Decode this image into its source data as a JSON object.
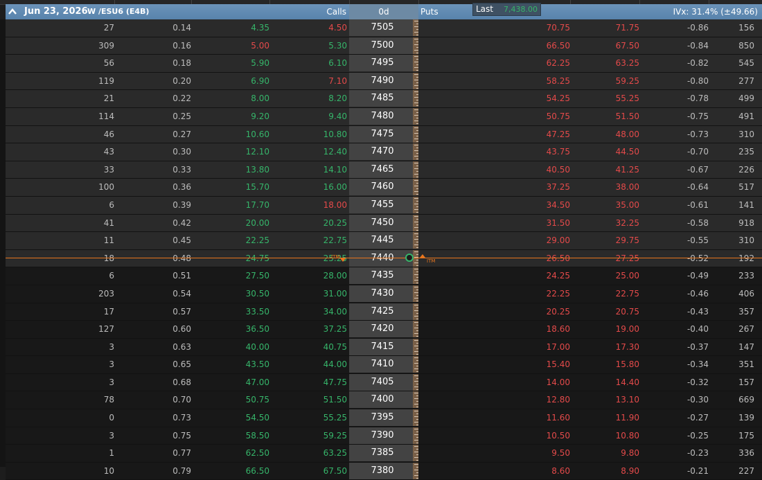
{
  "header": {
    "date": "Jun 23, 2026",
    "symbol": "W  /ESU6 (E4B)",
    "calls_label": "Calls",
    "expiration": "0d",
    "puts_label": "Puts",
    "ivx": "IVx: 31.4% (±49.66)"
  },
  "last_box": {
    "label": "Last",
    "value": "7,438.00"
  },
  "colors": {
    "header_bg": "#5f88b0",
    "itm_row": "#2a2a2a",
    "otm_row": "#181818",
    "green": "#36b56a",
    "red": "#e44a4a",
    "atm_line": "#e8761e"
  },
  "itm_label": "ITM",
  "rows": [
    {
      "c1": "27",
      "c2": "0.14",
      "bid": "4.35",
      "ask": "4.50",
      "strike": "7505",
      "pbid": "70.75",
      "pask": "71.75",
      "delta": "-0.86",
      "oi": "156",
      "bc": "green",
      "ac": "red",
      "pbc": "red",
      "pac": "red",
      "itm": true
    },
    {
      "c1": "309",
      "c2": "0.16",
      "bid": "5.00",
      "ask": "5.30",
      "strike": "7500",
      "pbid": "66.50",
      "pask": "67.50",
      "delta": "-0.84",
      "oi": "850",
      "bc": "red",
      "ac": "green",
      "pbc": "red",
      "pac": "red",
      "itm": true
    },
    {
      "c1": "56",
      "c2": "0.18",
      "bid": "5.90",
      "ask": "6.10",
      "strike": "7495",
      "pbid": "62.25",
      "pask": "63.25",
      "delta": "-0.82",
      "oi": "545",
      "bc": "green",
      "ac": "green",
      "pbc": "red",
      "pac": "red",
      "itm": true
    },
    {
      "c1": "119",
      "c2": "0.20",
      "bid": "6.90",
      "ask": "7.10",
      "strike": "7490",
      "pbid": "58.25",
      "pask": "59.25",
      "delta": "-0.80",
      "oi": "277",
      "bc": "green",
      "ac": "red",
      "pbc": "red",
      "pac": "red",
      "itm": true
    },
    {
      "c1": "21",
      "c2": "0.22",
      "bid": "8.00",
      "ask": "8.20",
      "strike": "7485",
      "pbid": "54.25",
      "pask": "55.25",
      "delta": "-0.78",
      "oi": "499",
      "bc": "green",
      "ac": "green",
      "pbc": "red",
      "pac": "red",
      "itm": true
    },
    {
      "c1": "114",
      "c2": "0.25",
      "bid": "9.20",
      "ask": "9.40",
      "strike": "7480",
      "pbid": "50.75",
      "pask": "51.50",
      "delta": "-0.75",
      "oi": "491",
      "bc": "green",
      "ac": "green",
      "pbc": "red",
      "pac": "red",
      "itm": true
    },
    {
      "c1": "46",
      "c2": "0.27",
      "bid": "10.60",
      "ask": "10.80",
      "strike": "7475",
      "pbid": "47.25",
      "pask": "48.00",
      "delta": "-0.73",
      "oi": "310",
      "bc": "green",
      "ac": "green",
      "pbc": "red",
      "pac": "red",
      "itm": true
    },
    {
      "c1": "43",
      "c2": "0.30",
      "bid": "12.10",
      "ask": "12.40",
      "strike": "7470",
      "pbid": "43.75",
      "pask": "44.50",
      "delta": "-0.70",
      "oi": "235",
      "bc": "green",
      "ac": "green",
      "pbc": "red",
      "pac": "red",
      "itm": true
    },
    {
      "c1": "33",
      "c2": "0.33",
      "bid": "13.80",
      "ask": "14.10",
      "strike": "7465",
      "pbid": "40.50",
      "pask": "41.25",
      "delta": "-0.67",
      "oi": "226",
      "bc": "green",
      "ac": "green",
      "pbc": "red",
      "pac": "red",
      "itm": true
    },
    {
      "c1": "100",
      "c2": "0.36",
      "bid": "15.70",
      "ask": "16.00",
      "strike": "7460",
      "pbid": "37.25",
      "pask": "38.00",
      "delta": "-0.64",
      "oi": "517",
      "bc": "green",
      "ac": "green",
      "pbc": "red",
      "pac": "red",
      "itm": true
    },
    {
      "c1": "6",
      "c2": "0.39",
      "bid": "17.70",
      "ask": "18.00",
      "strike": "7455",
      "pbid": "34.50",
      "pask": "35.00",
      "delta": "-0.61",
      "oi": "141",
      "bc": "green",
      "ac": "red",
      "pbc": "red",
      "pac": "red",
      "itm": true
    },
    {
      "c1": "41",
      "c2": "0.42",
      "bid": "20.00",
      "ask": "20.25",
      "strike": "7450",
      "pbid": "31.50",
      "pask": "32.25",
      "delta": "-0.58",
      "oi": "918",
      "bc": "green",
      "ac": "green",
      "pbc": "red",
      "pac": "red",
      "itm": true
    },
    {
      "c1": "11",
      "c2": "0.45",
      "bid": "22.25",
      "ask": "22.75",
      "strike": "7445",
      "pbid": "29.00",
      "pask": "29.75",
      "delta": "-0.55",
      "oi": "310",
      "bc": "green",
      "ac": "green",
      "pbc": "red",
      "pac": "red",
      "itm": true
    },
    {
      "c1": "18",
      "c2": "0.48",
      "bid": "24.75",
      "ask": "25.25",
      "strike": "7440",
      "pbid": "26.50",
      "pask": "27.25",
      "delta": "-0.52",
      "oi": "192",
      "bc": "green",
      "ac": "green",
      "pbc": "red",
      "pac": "red",
      "itm": true
    },
    {
      "c1": "6",
      "c2": "0.51",
      "bid": "27.50",
      "ask": "28.00",
      "strike": "7435",
      "pbid": "24.25",
      "pask": "25.00",
      "delta": "-0.49",
      "oi": "233",
      "bc": "green",
      "ac": "green",
      "pbc": "red",
      "pac": "red",
      "itm": false
    },
    {
      "c1": "203",
      "c2": "0.54",
      "bid": "30.50",
      "ask": "31.00",
      "strike": "7430",
      "pbid": "22.25",
      "pask": "22.75",
      "delta": "-0.46",
      "oi": "406",
      "bc": "green",
      "ac": "green",
      "pbc": "red",
      "pac": "red",
      "itm": false
    },
    {
      "c1": "17",
      "c2": "0.57",
      "bid": "33.50",
      "ask": "34.00",
      "strike": "7425",
      "pbid": "20.25",
      "pask": "20.75",
      "delta": "-0.43",
      "oi": "357",
      "bc": "green",
      "ac": "green",
      "pbc": "red",
      "pac": "red",
      "itm": false
    },
    {
      "c1": "127",
      "c2": "0.60",
      "bid": "36.50",
      "ask": "37.25",
      "strike": "7420",
      "pbid": "18.60",
      "pask": "19.00",
      "delta": "-0.40",
      "oi": "267",
      "bc": "green",
      "ac": "green",
      "pbc": "red",
      "pac": "red",
      "itm": false
    },
    {
      "c1": "3",
      "c2": "0.63",
      "bid": "40.00",
      "ask": "40.75",
      "strike": "7415",
      "pbid": "17.00",
      "pask": "17.30",
      "delta": "-0.37",
      "oi": "147",
      "bc": "green",
      "ac": "green",
      "pbc": "red",
      "pac": "red",
      "itm": false
    },
    {
      "c1": "3",
      "c2": "0.65",
      "bid": "43.50",
      "ask": "44.00",
      "strike": "7410",
      "pbid": "15.40",
      "pask": "15.80",
      "delta": "-0.34",
      "oi": "351",
      "bc": "green",
      "ac": "green",
      "pbc": "red",
      "pac": "red",
      "itm": false
    },
    {
      "c1": "3",
      "c2": "0.68",
      "bid": "47.00",
      "ask": "47.75",
      "strike": "7405",
      "pbid": "14.00",
      "pask": "14.40",
      "delta": "-0.32",
      "oi": "157",
      "bc": "green",
      "ac": "green",
      "pbc": "red",
      "pac": "red",
      "itm": false
    },
    {
      "c1": "78",
      "c2": "0.70",
      "bid": "50.75",
      "ask": "51.50",
      "strike": "7400",
      "pbid": "12.80",
      "pask": "13.10",
      "delta": "-0.30",
      "oi": "669",
      "bc": "green",
      "ac": "green",
      "pbc": "red",
      "pac": "red",
      "itm": false
    },
    {
      "c1": "0",
      "c2": "0.73",
      "bid": "54.50",
      "ask": "55.25",
      "strike": "7395",
      "pbid": "11.60",
      "pask": "11.90",
      "delta": "-0.27",
      "oi": "139",
      "bc": "green",
      "ac": "green",
      "pbc": "red",
      "pac": "red",
      "itm": false
    },
    {
      "c1": "3",
      "c2": "0.75",
      "bid": "58.50",
      "ask": "59.25",
      "strike": "7390",
      "pbid": "10.50",
      "pask": "10.80",
      "delta": "-0.25",
      "oi": "175",
      "bc": "green",
      "ac": "green",
      "pbc": "red",
      "pac": "red",
      "itm": false
    },
    {
      "c1": "1",
      "c2": "0.77",
      "bid": "62.50",
      "ask": "63.25",
      "strike": "7385",
      "pbid": "9.50",
      "pask": "9.80",
      "delta": "-0.23",
      "oi": "336",
      "bc": "green",
      "ac": "green",
      "pbc": "red",
      "pac": "red",
      "itm": false
    },
    {
      "c1": "10",
      "c2": "0.79",
      "bid": "66.50",
      "ask": "67.50",
      "strike": "7380",
      "pbid": "8.60",
      "pask": "8.90",
      "delta": "-0.21",
      "oi": "227",
      "bc": "green",
      "ac": "green",
      "pbc": "red",
      "pac": "red",
      "itm": false
    }
  ]
}
